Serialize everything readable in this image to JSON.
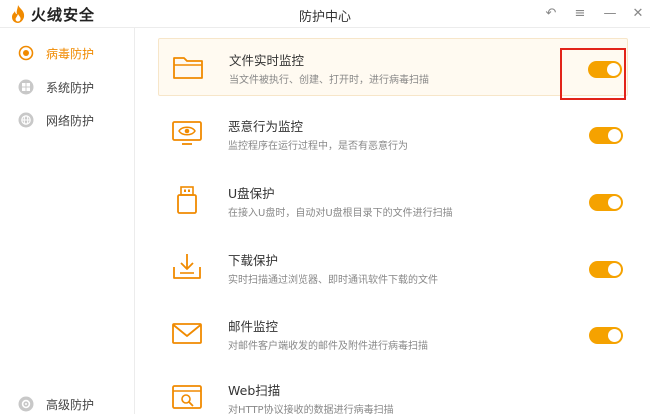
{
  "app": {
    "brand": "火绒安全",
    "window_title": "防护中心"
  },
  "window_controls": {
    "back": "↶",
    "menu": "≡",
    "minimize": "—",
    "close": "✕"
  },
  "sidebar": {
    "items": [
      {
        "label": "病毒防护",
        "icon": "target-icon",
        "active": true
      },
      {
        "label": "系统防护",
        "icon": "windows-icon",
        "active": false
      },
      {
        "label": "网络防护",
        "icon": "globe-icon",
        "active": false
      },
      {
        "label": "高级防护",
        "icon": "gear-icon",
        "active": false
      }
    ]
  },
  "protections": [
    {
      "title": "文件实时监控",
      "desc": "当文件被执行、创建、打开时，进行病毒扫描",
      "icon": "folder-icon",
      "enabled": true
    },
    {
      "title": "恶意行为监控",
      "desc": "监控程序在运行过程中，是否有恶意行为",
      "icon": "monitor-eye-icon",
      "enabled": true
    },
    {
      "title": "U盘保护",
      "desc": "在接入U盘时，自动对U盘根目录下的文件进行扫描",
      "icon": "usb-icon",
      "enabled": true
    },
    {
      "title": "下载保护",
      "desc": "实时扫描通过浏览器、即时通讯软件下载的文件",
      "icon": "download-icon",
      "enabled": true
    },
    {
      "title": "邮件监控",
      "desc": "对邮件客户端收发的邮件及附件进行病毒扫描",
      "icon": "mail-icon",
      "enabled": true
    },
    {
      "title": "Web扫描",
      "desc": "对HTTP协议接收的数据进行病毒扫描",
      "icon": "web-search-icon",
      "enabled": true
    }
  ],
  "colors": {
    "accent": "#f5a200",
    "active_text": "#f08a00",
    "highlight_box": "#e2231a"
  }
}
